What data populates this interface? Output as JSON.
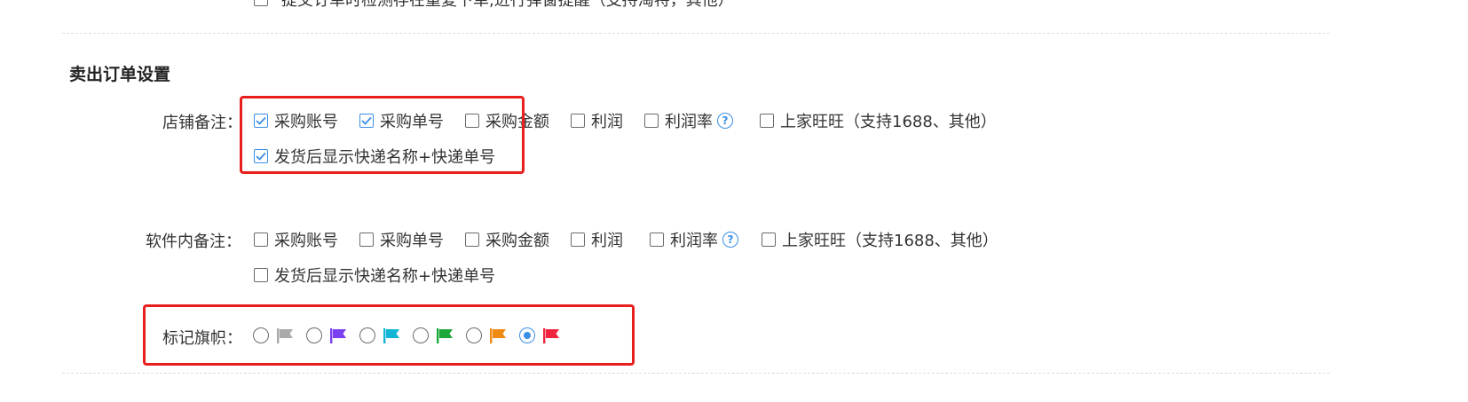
{
  "top_cut_row": {
    "text": "提交订单时检测存在重复下单,进行弹窗提醒（支持淘特，其他）"
  },
  "section": {
    "title": "卖出订单设置"
  },
  "shop_note": {
    "label": "店铺备注：",
    "options": [
      {
        "label": "采购账号",
        "checked": true
      },
      {
        "label": "采购单号",
        "checked": true
      },
      {
        "label": "采购金额",
        "checked": false
      },
      {
        "label": "利润",
        "checked": false
      },
      {
        "label": "利润率",
        "checked": false,
        "help_icon": "question-circle-icon"
      },
      {
        "label": "上家旺旺（支持1688、其他）",
        "checked": false
      }
    ],
    "extra_option": {
      "label": "发货后显示快递名称+快递单号",
      "checked": true
    }
  },
  "software_note": {
    "label": "软件内备注：",
    "options": [
      {
        "label": "采购账号",
        "checked": false
      },
      {
        "label": "采购单号",
        "checked": false
      },
      {
        "label": "采购金额",
        "checked": false
      },
      {
        "label": "利润",
        "checked": false
      },
      {
        "label": "利润率",
        "checked": false,
        "help_icon": "question-circle-icon"
      },
      {
        "label": "上家旺旺（支持1688、其他）",
        "checked": false
      }
    ],
    "extra_option": {
      "label": "发货后显示快递名称+快递单号",
      "checked": false
    }
  },
  "flag_marking": {
    "label": "标记旗帜：",
    "selected_index": 5,
    "flags": [
      {
        "color_name": "gray",
        "color": "#aaaaaa"
      },
      {
        "color_name": "purple",
        "color": "#7b3ff2"
      },
      {
        "color_name": "cyan",
        "color": "#12b5d6"
      },
      {
        "color_name": "green",
        "color": "#1ea83a"
      },
      {
        "color_name": "orange",
        "color": "#f08a12"
      },
      {
        "color_name": "red",
        "color": "#f0243f"
      }
    ]
  },
  "colors": {
    "accent": "#3a8ee6",
    "highlight_box": "#e8201d"
  }
}
